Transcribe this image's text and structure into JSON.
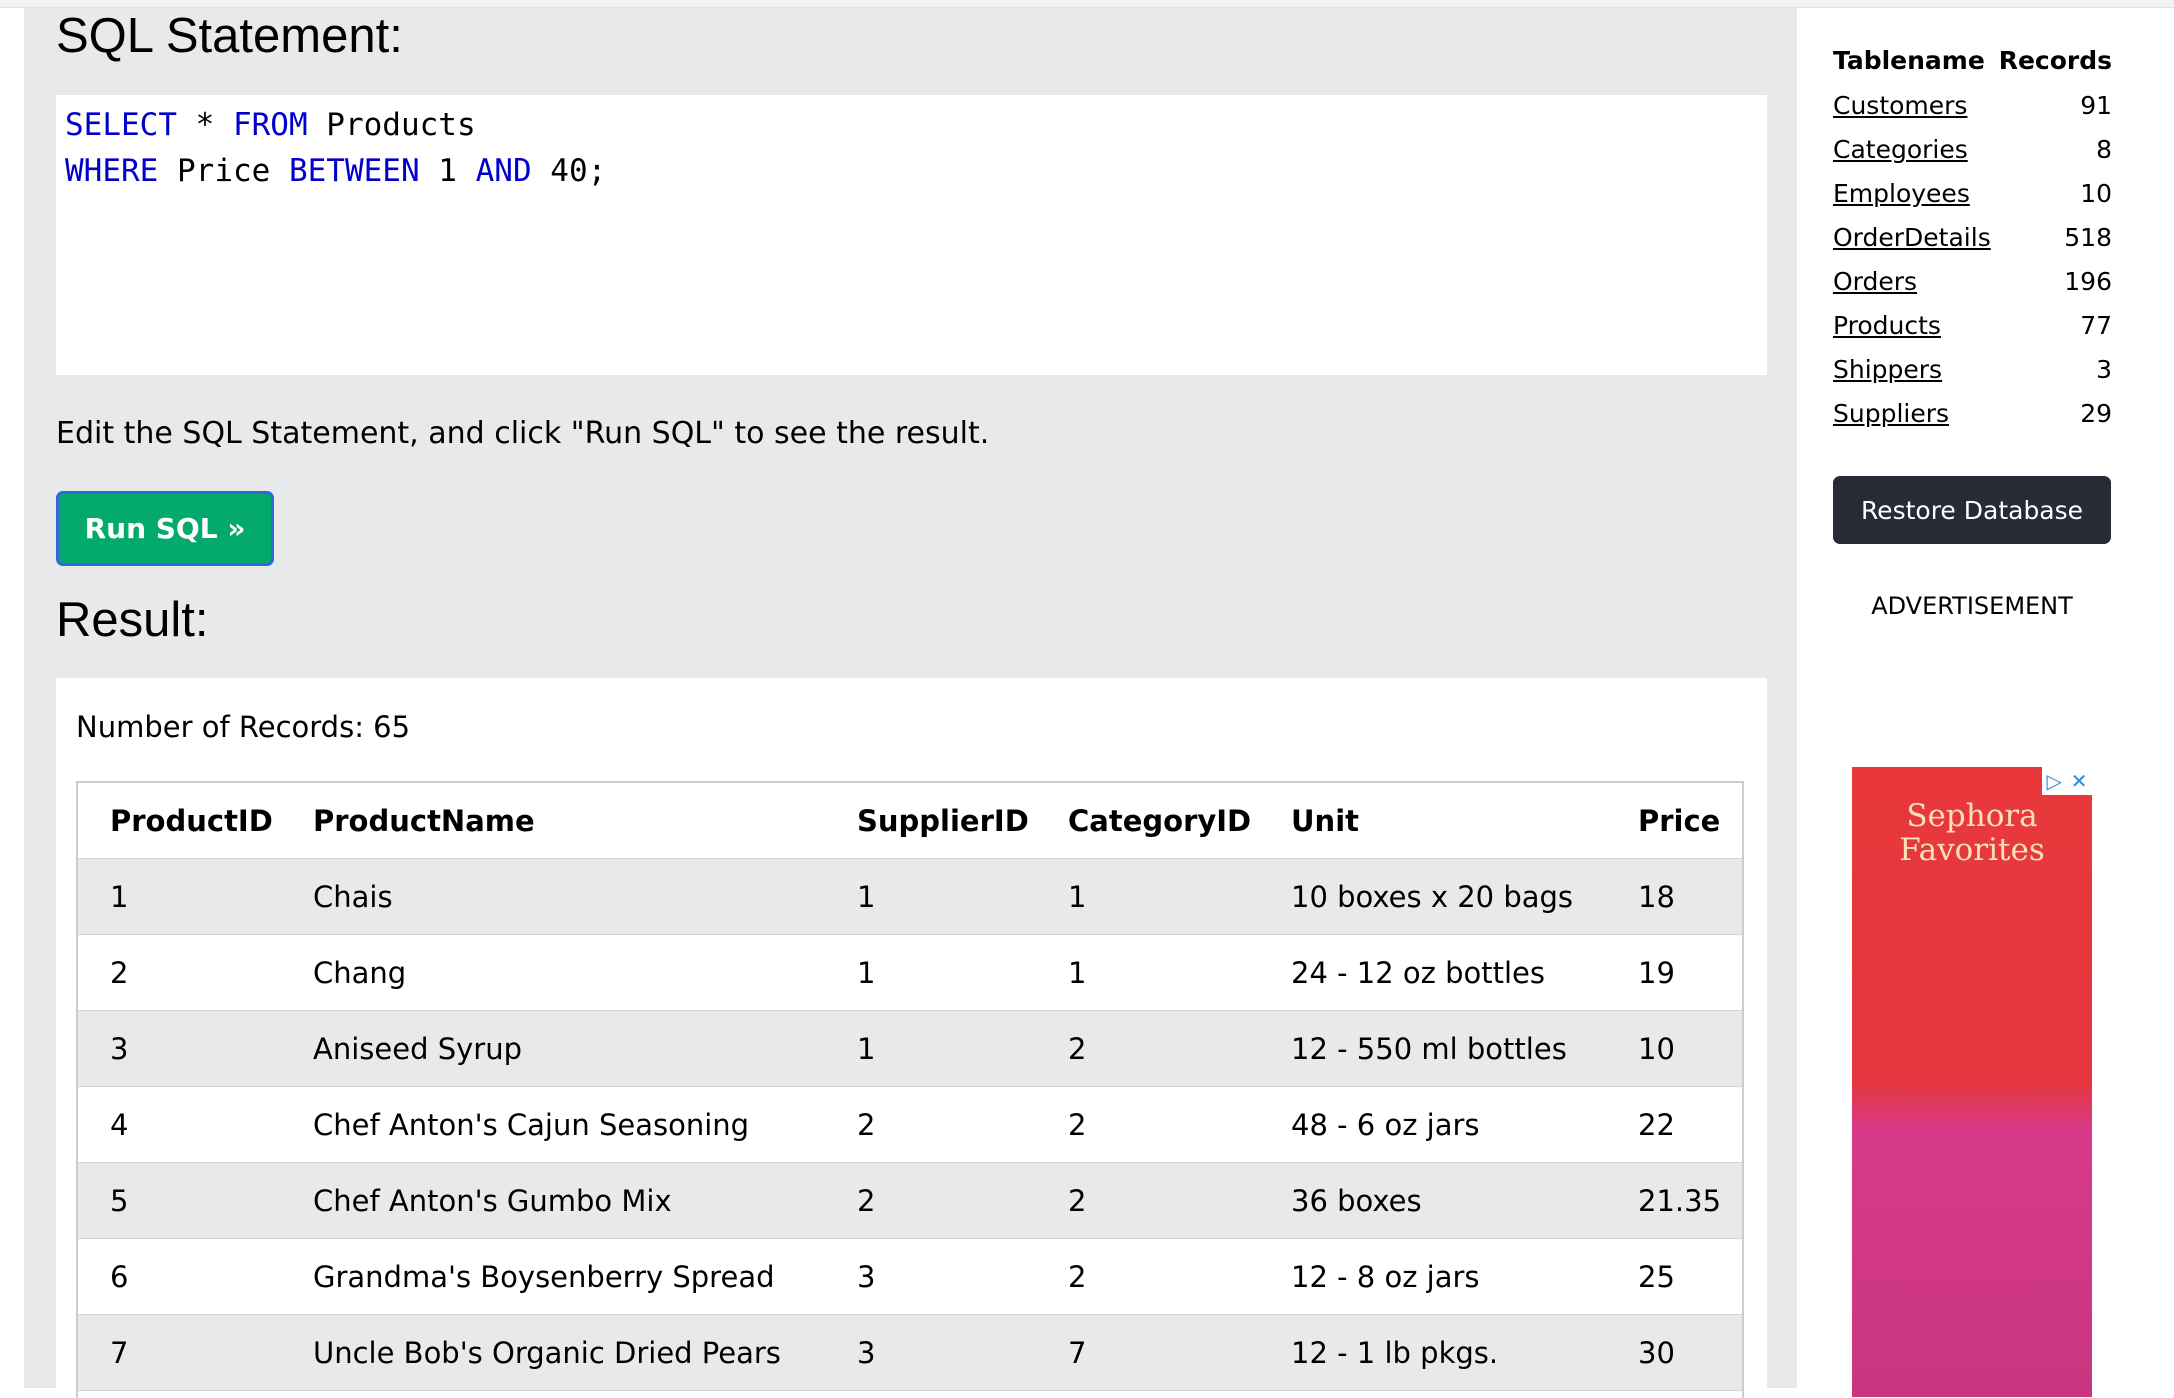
{
  "sql_editor": {
    "title": "SQL Statement:",
    "lines": [
      [
        {
          "t": "SELECT",
          "k": true
        },
        {
          "t": " * ",
          "k": false
        },
        {
          "t": "FROM",
          "k": true
        },
        {
          "t": " Products",
          "k": false
        }
      ],
      [
        {
          "t": "WHERE",
          "k": true
        },
        {
          "t": " Price ",
          "k": false
        },
        {
          "t": "BETWEEN",
          "k": true
        },
        {
          "t": " 1 ",
          "k": false
        },
        {
          "t": "AND",
          "k": true
        },
        {
          "t": " 40;",
          "k": false
        }
      ]
    ]
  },
  "instruction": "Edit the SQL Statement, and click \"Run SQL\" to see the result.",
  "run_button": "Run SQL »",
  "result": {
    "title": "Result:",
    "record_count": "Number of Records: 65",
    "columns": [
      "ProductID",
      "ProductName",
      "SupplierID",
      "CategoryID",
      "Unit",
      "Price"
    ],
    "rows": [
      [
        "1",
        "Chais",
        "1",
        "1",
        "10 boxes x 20 bags",
        "18"
      ],
      [
        "2",
        "Chang",
        "1",
        "1",
        "24 - 12 oz bottles",
        "19"
      ],
      [
        "3",
        "Aniseed Syrup",
        "1",
        "2",
        "12 - 550 ml bottles",
        "10"
      ],
      [
        "4",
        "Chef Anton's Cajun Seasoning",
        "2",
        "2",
        "48 - 6 oz jars",
        "22"
      ],
      [
        "5",
        "Chef Anton's Gumbo Mix",
        "2",
        "2",
        "36 boxes",
        "21.35"
      ],
      [
        "6",
        "Grandma's Boysenberry Spread",
        "3",
        "2",
        "12 - 8 oz jars",
        "25"
      ],
      [
        "7",
        "Uncle Bob's Organic Dried Pears",
        "3",
        "7",
        "12 - 1 lb pkgs.",
        "30"
      ]
    ]
  },
  "sidebar": {
    "header_table": "Tablename",
    "header_records": "Records",
    "tables": [
      {
        "name": "Customers",
        "count": "91"
      },
      {
        "name": "Categories",
        "count": "8"
      },
      {
        "name": "Employees",
        "count": "10"
      },
      {
        "name": "OrderDetails",
        "count": "518"
      },
      {
        "name": "Orders",
        "count": "196"
      },
      {
        "name": "Products",
        "count": "77"
      },
      {
        "name": "Shippers",
        "count": "3"
      },
      {
        "name": "Suppliers",
        "count": "29"
      }
    ],
    "restore_button": "Restore Database",
    "ad_label": "ADVERTISEMENT",
    "ad_brand": "Sephora Favorites"
  }
}
